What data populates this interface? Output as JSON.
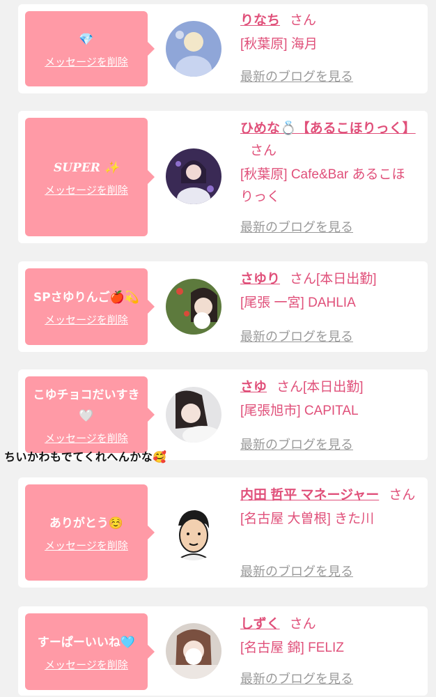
{
  "colors": {
    "accent": "#e0507a",
    "message_bg": "#ff9aa6",
    "link_gray": "#9a9a9a",
    "page_bg": "#f1f1f1"
  },
  "delete_label": "メッセージを削除",
  "blog_label": "最新のブログを見る",
  "overlay_text": "ちいかわもでてくれへんかな🥰",
  "items": [
    {
      "message": "💎",
      "name": "りなち",
      "honorific": "さん",
      "status": "",
      "shop": "[秋葉原] 海月"
    },
    {
      "message": "SUPER ✨",
      "name": "ひめな💍【あるこほりっく】",
      "honorific": "さん",
      "status": "",
      "shop": "[秋葉原] Cafe&Bar あるこほりっく"
    },
    {
      "message": "SPさゆりんご🍎💫",
      "name": "さゆり",
      "honorific": "さん",
      "status": "[本日出勤]",
      "shop": "[尾張 一宮] DAHLIA"
    },
    {
      "message": "こゆチョコだいすき🤍",
      "name": "さゆ",
      "honorific": "さん",
      "status": "[本日出勤]",
      "shop": "[尾張旭市] CAPITAL"
    },
    {
      "message": "ありがとう☺️",
      "name": "内田 哲平 マネージャー",
      "honorific": "さん",
      "status": "",
      "shop": "[名古屋 大曽根] きた川"
    },
    {
      "message": "すーぱーいいね🩵",
      "name": "しずく",
      "honorific": "さん",
      "status": "",
      "shop": "[名古屋 錦] FELIZ"
    }
  ]
}
